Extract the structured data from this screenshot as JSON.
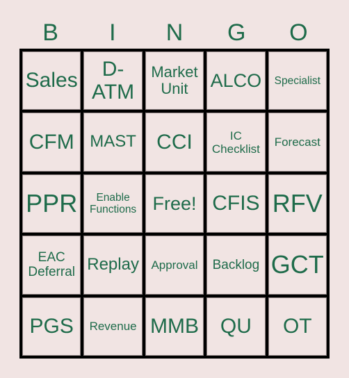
{
  "header": {
    "letters": [
      "B",
      "I",
      "N",
      "G",
      "O"
    ]
  },
  "colors": {
    "background": "#f1e4e3",
    "text": "#1e6b4a",
    "grid": "#000000"
  },
  "board": {
    "rows": [
      [
        "Sales",
        "D-ATM",
        "Market Unit",
        "ALCO",
        "Specialist"
      ],
      [
        "CFM",
        "MAST",
        "CCI",
        "IC Checklist",
        "Forecast"
      ],
      [
        "PPR",
        "Enable Functions",
        "Free!",
        "CFIS",
        "RFV"
      ],
      [
        "EAC Deferral",
        "Replay",
        "Approval",
        "Backlog",
        "GCT"
      ],
      [
        "PGS",
        "Revenue",
        "MMB",
        "QU",
        "OT"
      ]
    ]
  }
}
